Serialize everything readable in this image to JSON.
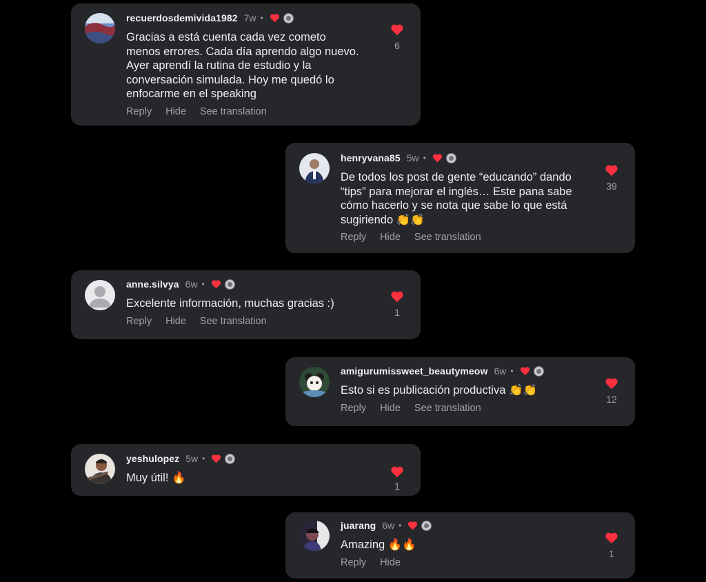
{
  "comments": [
    {
      "username": "recuerdosdemivida1982",
      "time": "7w",
      "text": "Gracias a está cuenta cada vez cometo\nmenos errores. Cada día aprendo algo nuevo.\nAyer aprendí la rutina de estudio y la\nconversación simulada. Hoy me quedó lo\nenfocarme en el speaking",
      "likes": "6",
      "actions": [
        "Reply",
        "Hide",
        "See translation"
      ],
      "avatar_color": "#5b6f9c"
    },
    {
      "username": "henryvana85",
      "time": "5w",
      "text": "De todos los post de gente “educando” dando\n“tips” para mejorar el inglés… Este pana sabe\ncómo hacerlo y se nota que sabe lo que está\nsugiriendo 👏👏",
      "likes": "39",
      "actions": [
        "Reply",
        "Hide",
        "See translation"
      ],
      "avatar_color": "#d9dde4"
    },
    {
      "username": "anne.silvya",
      "time": "6w",
      "text": "Excelente información, muchas gracias :)",
      "likes": "1",
      "actions": [
        "Reply",
        "Hide",
        "See translation"
      ],
      "avatar_color": "#e7e8ea"
    },
    {
      "username": "amigurumissweet_beautymeow",
      "time": "6w",
      "text": "Esto si es publicación productiva 👏👏",
      "likes": "12",
      "actions": [
        "Reply",
        "Hide",
        "See translation"
      ],
      "avatar_color": "#3c5a3e"
    },
    {
      "username": "yeshulopez",
      "time": "5w",
      "text": "Muy útil! 🔥",
      "likes": "1",
      "actions": [],
      "avatar_color": "#b7a58e"
    },
    {
      "username": "juarang",
      "time": "6w",
      "text": "Amazing 🔥🔥",
      "likes": "1",
      "actions": [
        "Reply",
        "Hide"
      ],
      "avatar_color": "#3a2f4c"
    }
  ],
  "colors": {
    "card_bg": "#26272b",
    "heart": "#ff3040",
    "secondary_text": "#a0a2a8"
  },
  "icons": {
    "like": "heart-icon",
    "creator_liked": "small-heart-icon",
    "creator_avatar": "creator-avatar-icon"
  }
}
